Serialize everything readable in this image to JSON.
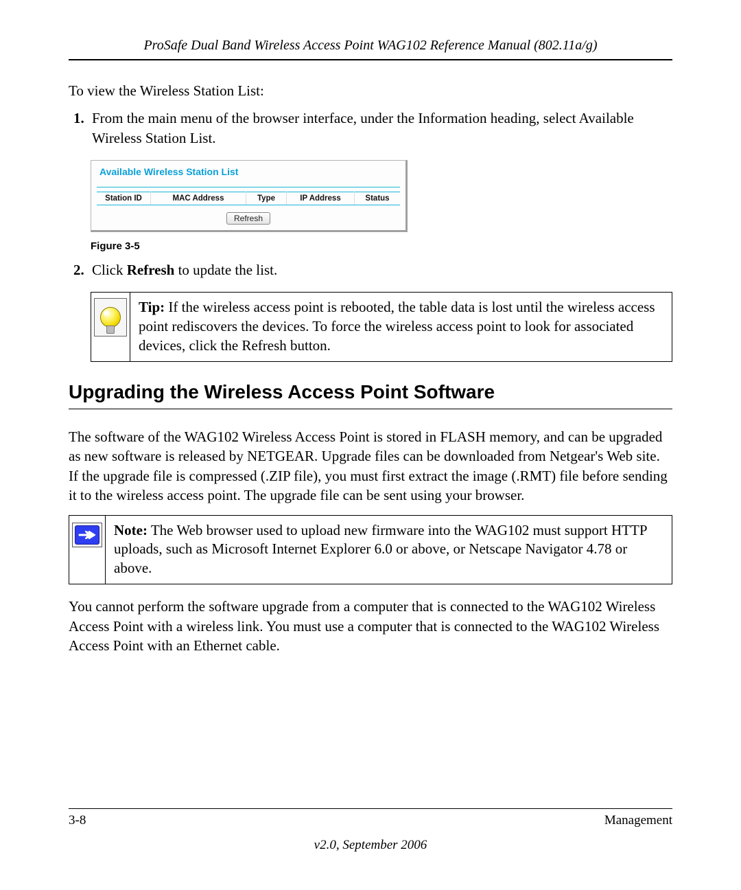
{
  "header": {
    "title": "ProSafe Dual Band Wireless Access Point WAG102 Reference Manual (802.11a/g)"
  },
  "intro": "To view the Wireless Station List:",
  "steps": [
    "From the main menu of the browser interface, under the Information heading, select Available Wireless Station List."
  ],
  "ui_panel": {
    "title": "Available Wireless Station List",
    "columns": [
      "Station ID",
      "MAC Address",
      "Type",
      "IP Address",
      "Status"
    ],
    "refresh_label": "Refresh"
  },
  "figure_caption": "Figure 3-5",
  "step2_prefix": "Click ",
  "step2_bold": "Refresh",
  "step2_suffix": " to update the list.",
  "tip": {
    "label": "Tip:",
    "text": " If the wireless access point is rebooted, the table data is lost until the wireless access point rediscovers the devices. To force the wireless access point to look for associated devices, click the Refresh button."
  },
  "section_heading": "Upgrading the Wireless Access Point Software",
  "paragraph1": "The software of the WAG102 Wireless Access Point is stored in FLASH memory, and can be upgraded as new software is released by NETGEAR. Upgrade files can be downloaded from Netgear's Web site. If the upgrade file is compressed (.ZIP file), you must first extract the image (.RMT) file before sending it to the wireless access point. The upgrade file can be sent using your browser.",
  "note": {
    "label": "Note:",
    "text": " The Web browser used to upload new firmware into the WAG102 must support HTTP uploads, such as Microsoft Internet Explorer 6.0 or above, or Netscape Navigator 4.78 or above."
  },
  "paragraph2": "You cannot perform the software upgrade from a computer that is connected to the WAG102 Wireless Access Point with a wireless link. You must use a computer that is connected to the WAG102 Wireless Access Point with an Ethernet cable.",
  "footer": {
    "page": "3-8",
    "section": "Management",
    "version": "v2.0, September 2006"
  }
}
